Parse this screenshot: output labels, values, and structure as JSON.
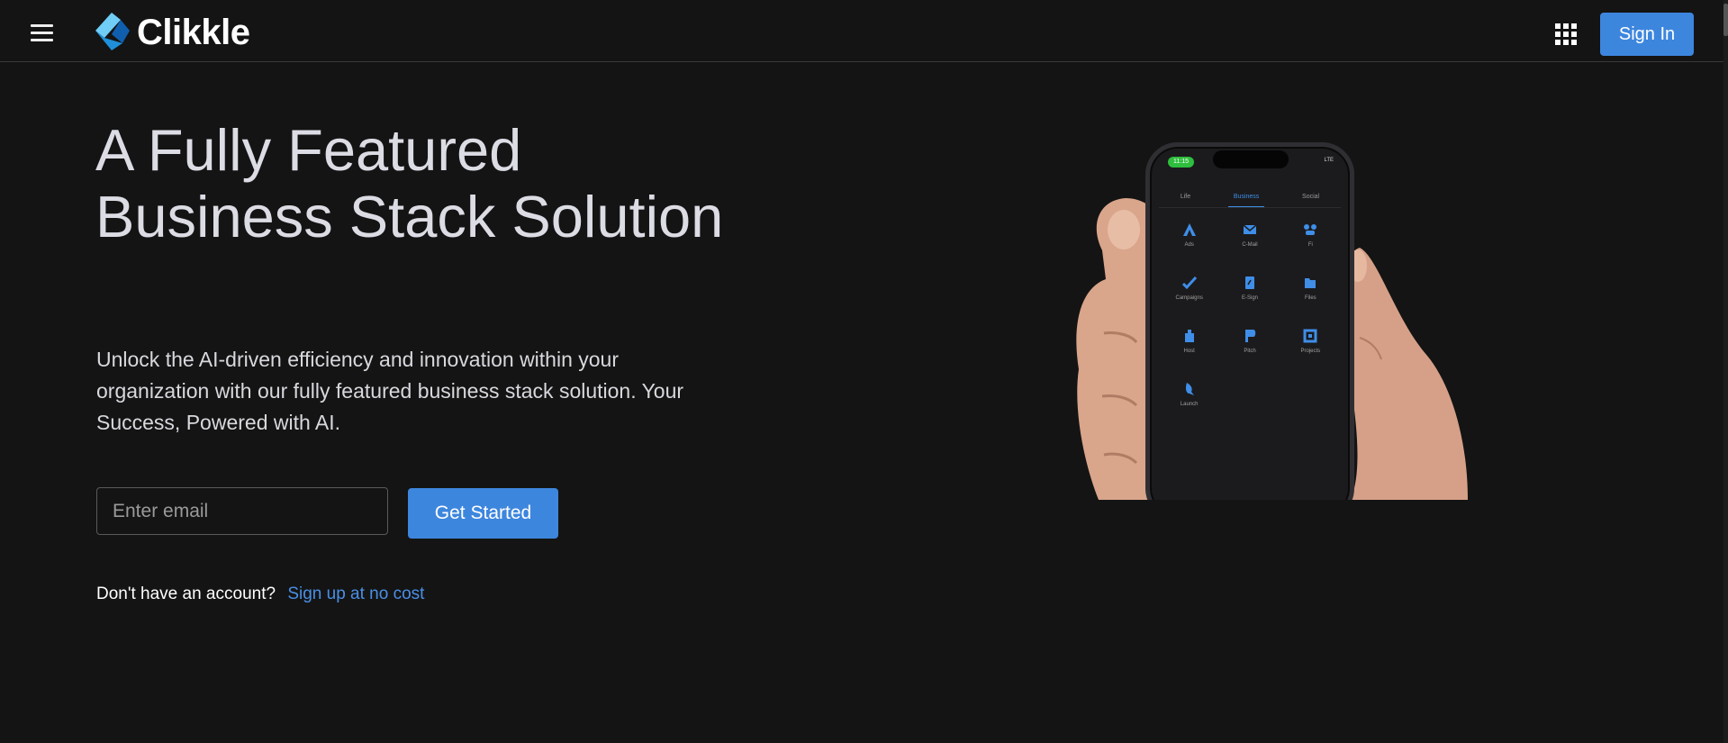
{
  "header": {
    "brand_name": "Clikkle",
    "menu_icon": "hamburger-menu-icon",
    "apps_icon": "apps-grid-icon",
    "sign_in_label": "Sign In"
  },
  "hero": {
    "title": "A Fully Featured Business Stack Solution",
    "subtitle": "Unlock the AI-driven efficiency and innovation within your organization with our fully featured business stack solution. Your Success, Powered with AI.",
    "email_placeholder": "Enter email",
    "email_value": "",
    "get_started_label": "Get Started",
    "account_prompt": "Don't have an account?",
    "signup_link": "Sign up at no cost"
  },
  "phone": {
    "time": "11:15",
    "status": "LTE",
    "tabs": [
      "Life",
      "Business",
      "Social"
    ],
    "active_tab": "Business",
    "apps": [
      {
        "label": "Ads",
        "icon": "ads-icon"
      },
      {
        "label": "C-Mail",
        "icon": "mail-icon"
      },
      {
        "label": "Fi",
        "icon": "fi-icon"
      },
      {
        "label": "Campaigns",
        "icon": "campaigns-icon"
      },
      {
        "label": "E-Sign",
        "icon": "esign-icon"
      },
      {
        "label": "Files",
        "icon": "files-icon"
      },
      {
        "label": "Host",
        "icon": "host-icon"
      },
      {
        "label": "Pitch",
        "icon": "pitch-icon"
      },
      {
        "label": "Projects",
        "icon": "projects-icon"
      },
      {
        "label": "Launch",
        "icon": "launch-icon"
      }
    ]
  },
  "colors": {
    "background": "#141414",
    "accent": "#3d86de",
    "link": "#4a8fe6",
    "phone_active_tab": "#3f8ee8",
    "status_pill": "#2fbf3e"
  }
}
